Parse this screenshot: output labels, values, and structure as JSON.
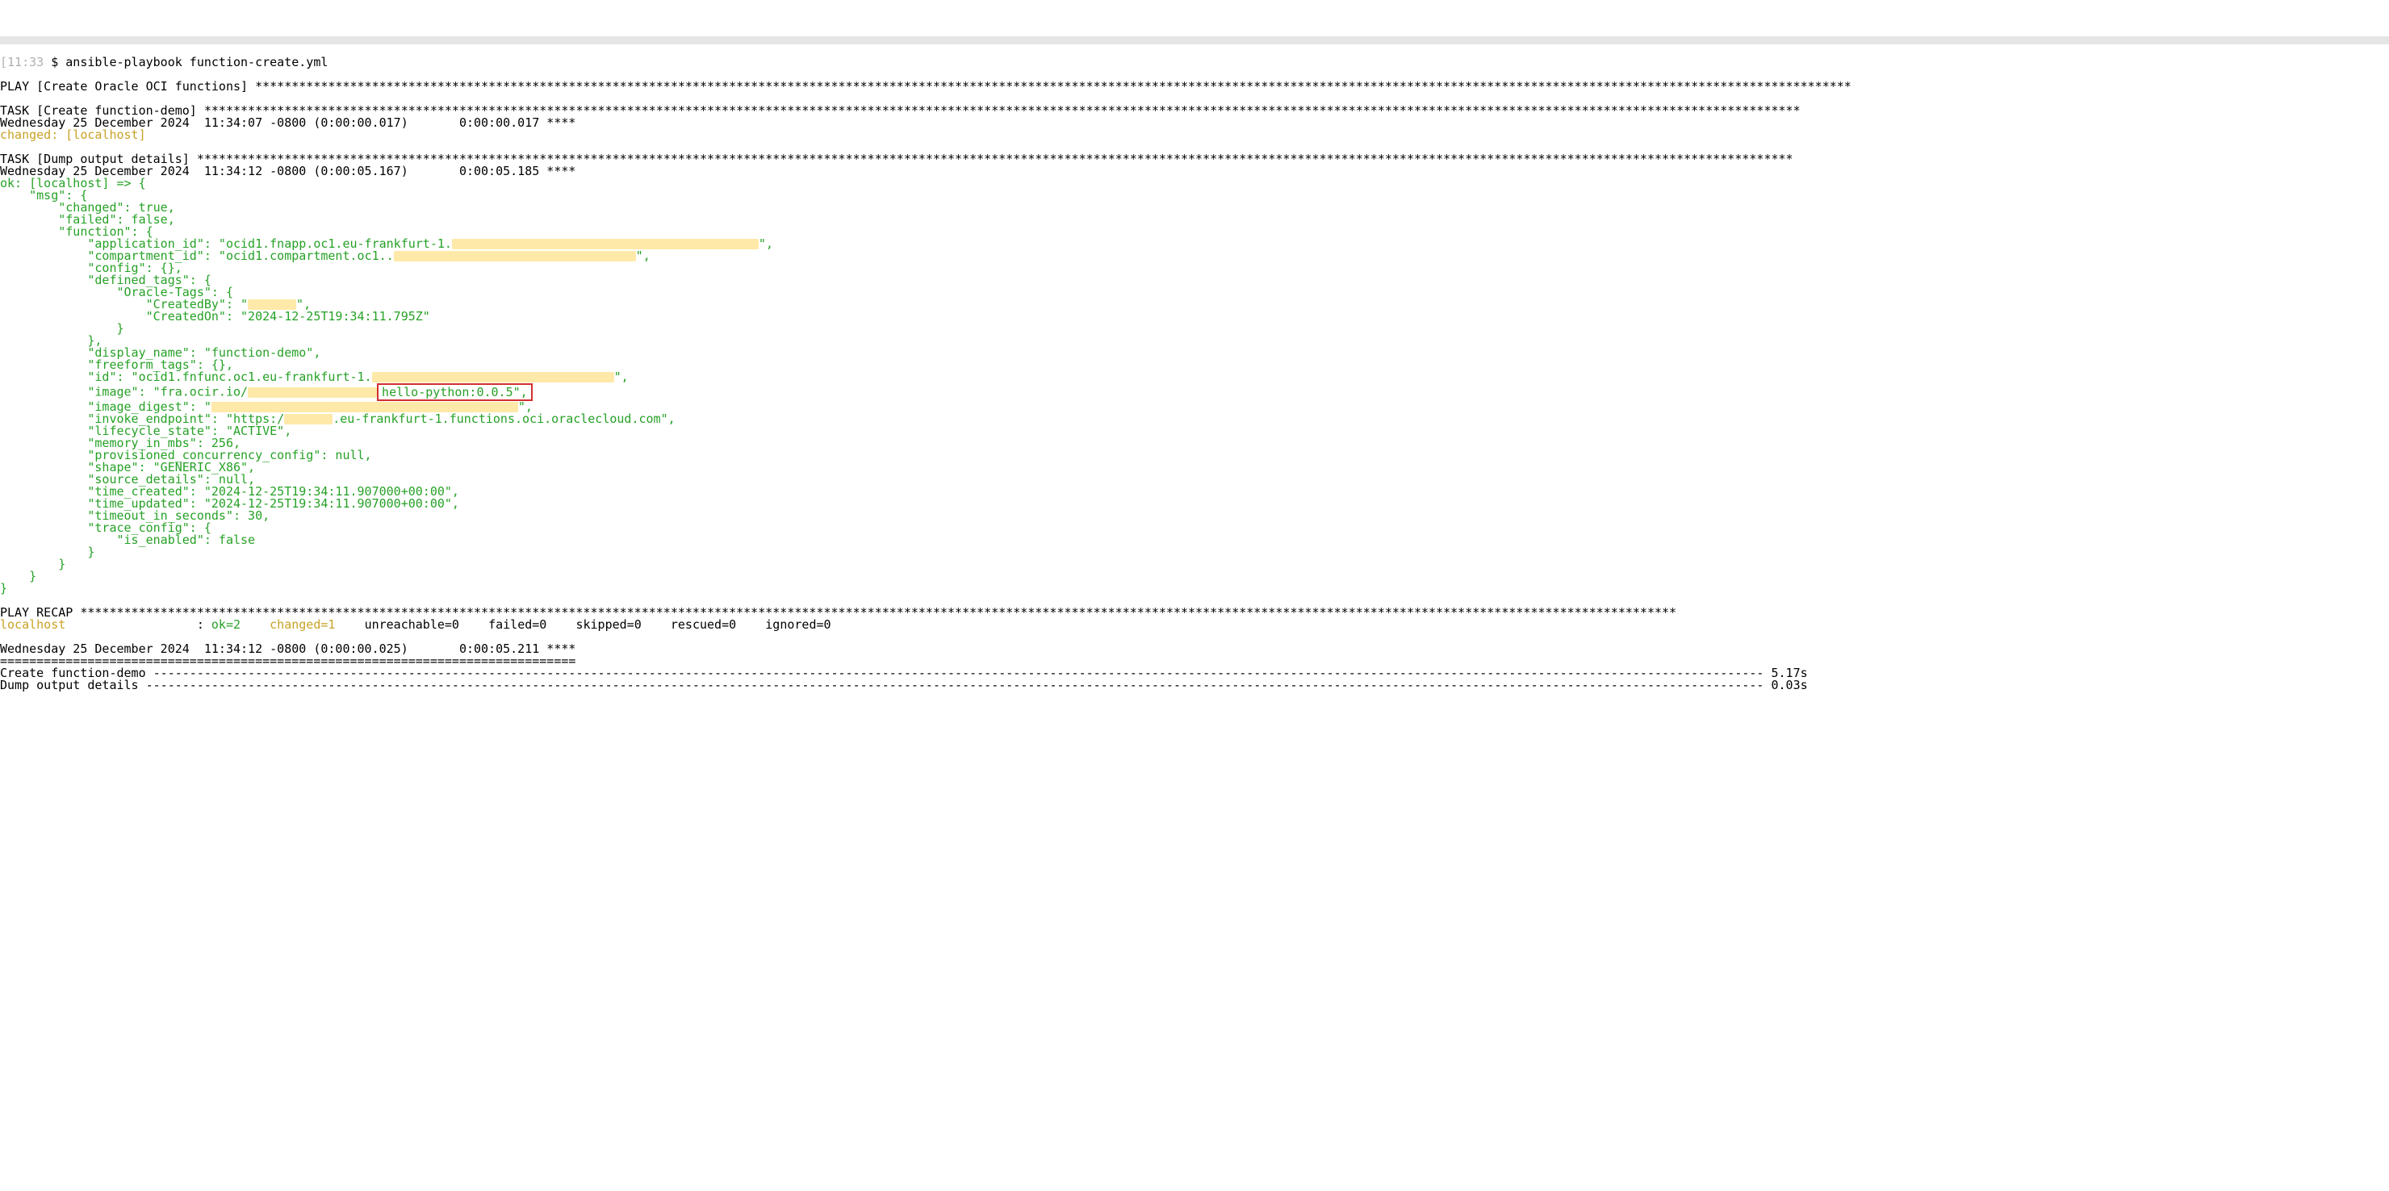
{
  "prompt": {
    "time": "[11:33",
    "symbol": "$",
    "cmd": "ansible-playbook function-create.yml"
  },
  "play": {
    "header": "PLAY [Create Oracle OCI functions]"
  },
  "task1": {
    "header": "TASK [Create function-demo]",
    "ts": "Wednesday 25 December 2024  11:34:07 -0800 (0:00:00.017)       0:00:00.017 ****",
    "status": "changed: [localhost]"
  },
  "task2": {
    "header": "TASK [Dump output details]",
    "ts": "Wednesday 25 December 2024  11:34:12 -0800 (0:00:05.167)       0:00:05.185 ****",
    "ok": "ok: [localhost] => {",
    "msg_open": "    \"msg\": {",
    "changed_kv": "        \"changed\": true,",
    "failed_kv": "        \"failed\": false,",
    "fn_open": "        \"function\": {",
    "appid_k": "            \"application_id\": \"ocid1.fnapp.oc1.eu-frankfurt-1.",
    "appid_tail": "\",",
    "comp_k": "            \"compartment_id\": \"ocid1.compartment.oc1..",
    "comp_tail": "\",",
    "config": "            \"config\": {},",
    "dtags_open": "            \"defined_tags\": {",
    "ortags_open": "                \"Oracle-Tags\": {",
    "created_by_k": "                    \"CreatedBy\": \"",
    "created_by_tail": "\",",
    "created_on": "                    \"CreatedOn\": \"2024-12-25T19:34:11.795Z\"",
    "ortags_close": "                }",
    "dtags_close": "            },",
    "display": "            \"display_name\": \"function-demo\",",
    "fftags": "            \"freeform_tags\": {},",
    "id_k": "            \"id\": \"ocid1.fnfunc.oc1.eu-frankfurt-1.",
    "id_tail": "\",",
    "img_k": "            \"image\": \"fra.ocir.io/",
    "img_box": "hello-python:0.0.5\",",
    "digest_k": "            \"image_digest\": \"",
    "digest_tail": "\",",
    "invoke_k": "            \"invoke_endpoint\": \"https:/",
    "invoke_tail": ".eu-frankfurt-1.functions.oci.oraclecloud.com\",",
    "lifecycle": "            \"lifecycle_state\": \"ACTIVE\",",
    "mem": "            \"memory_in_mbs\": 256,",
    "pcc": "            \"provisioned_concurrency_config\": null,",
    "shape": "            \"shape\": \"GENERIC_X86\",",
    "sdet": "            \"source_details\": null,",
    "tc": "            \"time_created\": \"2024-12-25T19:34:11.907000+00:00\",",
    "tu": "            \"time_updated\": \"2024-12-25T19:34:11.907000+00:00\",",
    "tos": "            \"timeout_in_seconds\": 30,",
    "trace_open": "            \"trace_config\": {",
    "trace_en": "                \"is_enabled\": false",
    "trace_close": "            }",
    "fn_close": "        }",
    "msg_close": "    }",
    "root_close": "}"
  },
  "recap": {
    "header": "PLAY RECAP",
    "host": "localhost",
    "ok": "ok=2",
    "changed": "changed=1",
    "rest": "unreachable=0    failed=0    skipped=0    rescued=0    ignored=0",
    "ts": "Wednesday 25 December 2024  11:34:12 -0800 (0:00:00.025)       0:00:05.211 ****",
    "eq": "===============================================================================",
    "row1_name": "Create function-demo",
    "row1_time": "5.17s",
    "row2_name": "Dump output details",
    "row2_time": "0.03s"
  },
  "stars": "***************************************************************************************************************************************************************************************************************************"
}
